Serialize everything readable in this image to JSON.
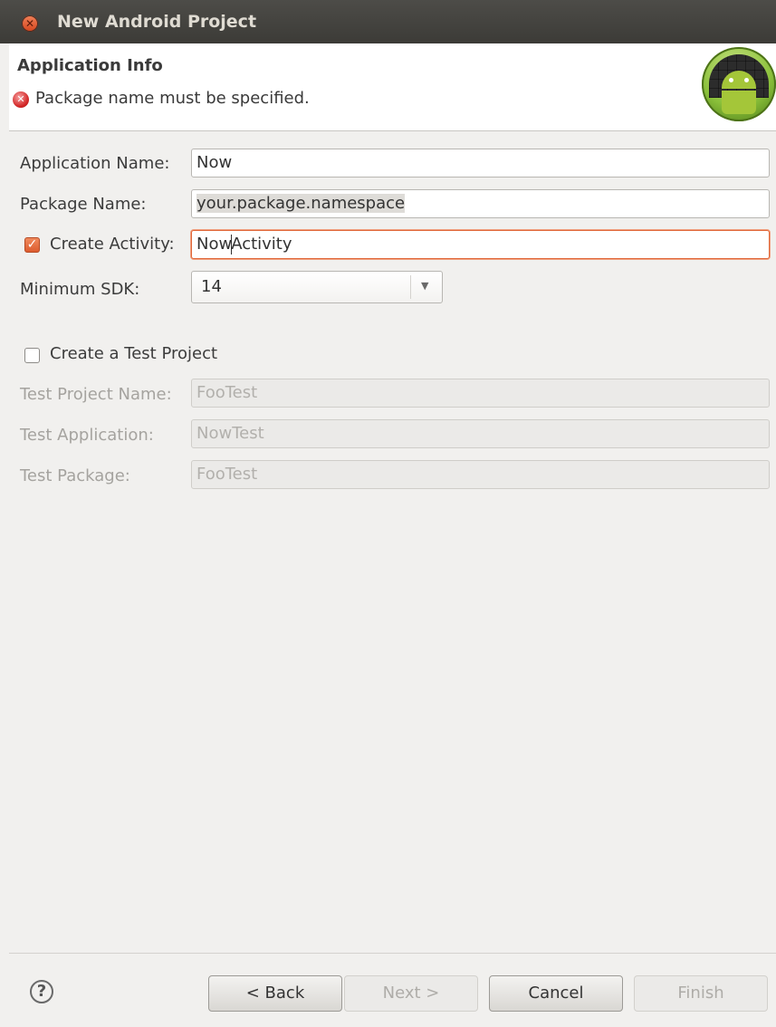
{
  "window": {
    "title": "New Android Project"
  },
  "header": {
    "title": "Application Info",
    "error_message": "Package name must be specified."
  },
  "form": {
    "app_name_label": "Application Name:",
    "app_name_value": "Now",
    "package_label": "Package Name:",
    "package_value": "your.package.namespace",
    "create_activity_label": "Create Activity:",
    "create_activity_checked": true,
    "activity_value_before_caret": "Now",
    "activity_value_after_caret": "Activity",
    "min_sdk_label": "Minimum SDK:",
    "min_sdk_value": "14"
  },
  "test_project": {
    "checkbox_label": "Create a Test Project",
    "checked": false,
    "name_label": "Test Project Name:",
    "name_value": "FooTest",
    "app_label": "Test Application:",
    "app_value": "NowTest",
    "package_label": "Test Package:",
    "package_value": "FooTest"
  },
  "buttons": {
    "help_glyph": "?",
    "back": "< Back",
    "next": "Next >",
    "cancel": "Cancel",
    "finish": "Finish"
  },
  "colors": {
    "accent": "#e0683a",
    "error": "#d22525",
    "titlebar": "#3c3b37"
  }
}
